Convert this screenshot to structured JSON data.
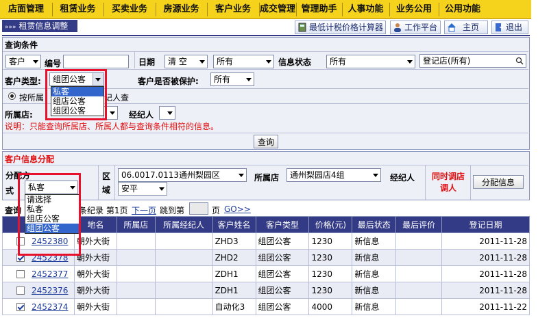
{
  "nav": {
    "items": [
      "店面管理",
      "租赁业务",
      "买卖业务",
      "房源业务",
      "客户业务",
      "成交管理",
      "管理助手",
      "人事功能",
      "业务公用",
      "公用功能"
    ]
  },
  "titlebar": {
    "prefix": "»»»",
    "title": "租赁信息调整"
  },
  "toolbar": {
    "tax_calc": "最低计税价格计算器",
    "workbench": "工作平台",
    "home": "主页",
    "logout": "退出"
  },
  "query": {
    "section_title": "查询条件",
    "type_select": "客户",
    "code_label": "编号",
    "code_value": "",
    "date_label": "日期",
    "date_clear": "清  空",
    "date_range": "所有",
    "status_label": "信息状态",
    "status_value": "所有",
    "store_value": "登记店(所有)",
    "customer_type_label": "客户类型:",
    "customer_type_value": "组团公客",
    "protected_label": "客户是否被保护:",
    "protected_value": "所有",
    "radio_label_a": "按所属",
    "radio_label_b": "记人查",
    "store_label": "所属店:",
    "agent_label": "经纪人",
    "note": "说明：只能查询所属店、所属人都与查询条件相符的信息。",
    "search_button": "查询"
  },
  "customer_type_dropdown": {
    "options": [
      "私客",
      "组店公客",
      "组团公客"
    ],
    "highlighted": "私客"
  },
  "assign": {
    "section_title": "客户信息分配",
    "method_label_a": "分配方",
    "method_label_b": "式",
    "method_value": "私客",
    "area_label_a": "区",
    "area_label_b": "域",
    "area_value": "06.0017.0113通州梨园区",
    "district_value": "安平",
    "store_label": "所属店",
    "store_value": "通州梨园店4组",
    "agent_label": "经纪人",
    "sync_label_a": "同时调店",
    "sync_label_b": "调人",
    "assign_button": "分配信息"
  },
  "method_dropdown": {
    "options": [
      "请选择",
      "私客",
      "组店公客",
      "组团公客"
    ],
    "highlighted": "组团公客"
  },
  "pager": {
    "prefix": "查询",
    "text_a": "条纪录 第1页",
    "next": "下一页",
    "jump": "跳到第",
    "page_unit": "页",
    "go": "GO>>"
  },
  "table": {
    "headers": [
      "",
      "地名",
      "所属店",
      "所属经纪人",
      "客户姓名",
      "客户类型",
      "价格(元)",
      "最后状态",
      "最后评价",
      "登记日期"
    ],
    "rows": [
      {
        "checked": false,
        "id": "2452380",
        "place": "朝外大街",
        "store": "",
        "agent": "",
        "name": "ZHD3",
        "type": "组团公客",
        "price": "1230",
        "status": "新信息",
        "review": "",
        "date": "2011-11-28"
      },
      {
        "checked": true,
        "id": "2452378",
        "place": "朝外大街",
        "store": "",
        "agent": "",
        "name": "ZHD2",
        "type": "组团公客",
        "price": "1230",
        "status": "新信息",
        "review": "",
        "date": "2011-11-28"
      },
      {
        "checked": false,
        "id": "2452377",
        "place": "朝外大街",
        "store": "",
        "agent": "",
        "name": "ZDH1",
        "type": "组团公客",
        "price": "1230",
        "status": "新信息",
        "review": "",
        "date": "2011-11-28"
      },
      {
        "checked": false,
        "id": "2452376",
        "place": "朝外大街",
        "store": "",
        "agent": "",
        "name": "ZDH1",
        "type": "组团公客",
        "price": "1230",
        "status": "新信息",
        "review": "",
        "date": "2011-11-28"
      },
      {
        "checked": true,
        "id": "2452374",
        "place": "朝外大街",
        "store": "",
        "agent": "",
        "name": "自动化3",
        "type": "组团公客",
        "price": "4000",
        "status": "新信息",
        "review": "",
        "date": "2011-11-22"
      }
    ]
  },
  "colors": {
    "nav_bg": "#f5d21c",
    "header_blue": "#333a86",
    "panel_bg": "#eef0f8",
    "highlight": "#3366cc",
    "callout_red": "#e8112b",
    "note_red": "#e01010"
  }
}
